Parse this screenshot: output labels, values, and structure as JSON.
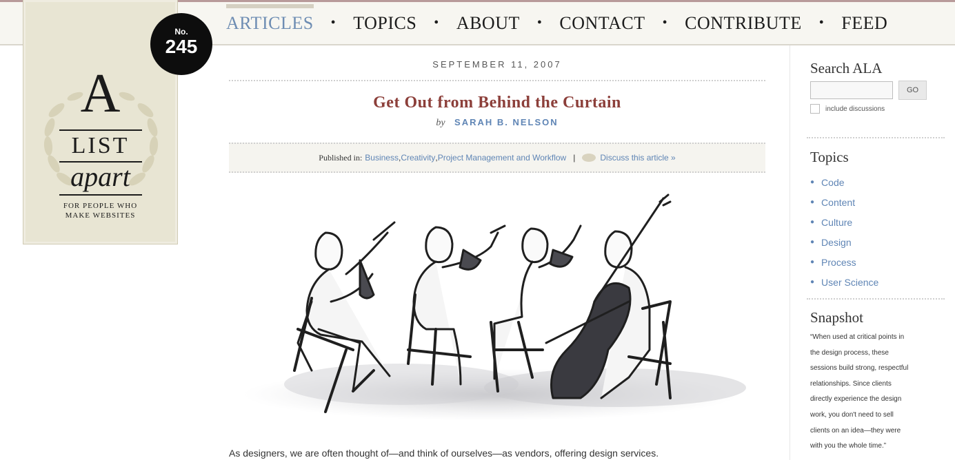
{
  "nav": {
    "items": [
      "ARTICLES",
      "TOPICS",
      "ABOUT",
      "CONTACT",
      "CONTRIBUTE",
      "FEED"
    ],
    "separator": "•",
    "active": "ARTICLES"
  },
  "logo": {
    "letter": "A",
    "word1": "LIST",
    "word2": "apart",
    "tagline_line1": "FOR PEOPLE WHO",
    "tagline_line2": "MAKE WEBSITES"
  },
  "issue": {
    "prefix": "No.",
    "number": "245"
  },
  "article": {
    "date": "SEPTEMBER 11, 2007",
    "title": "Get Out from Behind the Curtain",
    "by": "by",
    "author": "SARAH B. NELSON",
    "published_label": "Published in:",
    "categories": [
      "Business",
      "Creativity",
      "Project Management and Workflow"
    ],
    "category_sep": ", ",
    "pipe": "|",
    "discuss": "Discuss this article »",
    "lead": "As designers, we are often thought of—and think of ourselves—as vendors, offering design services."
  },
  "sidebar": {
    "search_title": "Search ALA",
    "search_value": "",
    "go_label": "GO",
    "include_label": "include discussions",
    "topics_title": "Topics",
    "topics": [
      "Code",
      "Content",
      "Culture",
      "Design",
      "Process",
      "User Science"
    ],
    "snapshot_title": "Snapshot",
    "snapshot_lines": [
      "“When used at critical points in",
      "the design process, these",
      "sessions build strong, respectful",
      "relationships. Since clients",
      "directly experience the design",
      "work, you don't need to sell",
      "clients on an idea—they were",
      "with you the whole time.”"
    ]
  },
  "colors": {
    "link": "#5f85b5",
    "title": "#8c3f3a",
    "nav_active": "#6e8db3",
    "logo_bg": "#e8e5d3"
  },
  "icons": [
    "wreath-icon",
    "bubble-icon",
    "bullet-icon"
  ]
}
